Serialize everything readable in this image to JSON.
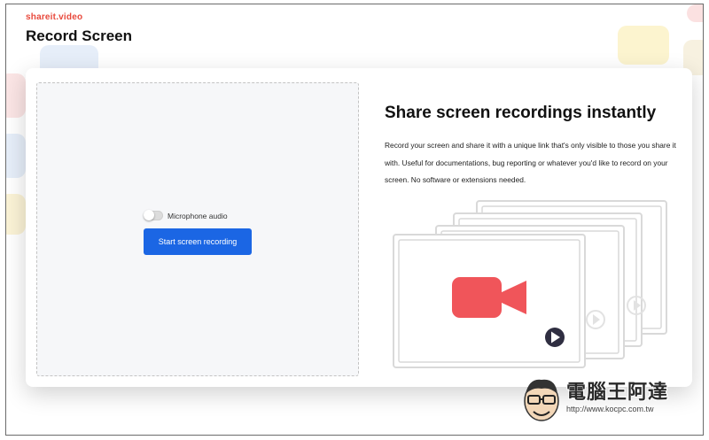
{
  "header": {
    "brand": "shareit.video",
    "page_title": "Record Screen"
  },
  "recorder": {
    "mic_label": "Microphone audio",
    "mic_enabled": false,
    "start_button_label": "Start screen recording"
  },
  "info": {
    "heading": "Share screen recordings instantly",
    "description": "Record your screen and share it with a unique link that's only visible to those you share it with. Useful for documentations, bug reporting or whatever you'd like to record on your screen. No software or extensions needed."
  },
  "illustration": {
    "camera_icon": "video-camera-icon",
    "play_icon": "play-icon"
  },
  "watermark": {
    "title": "電腦王阿達",
    "url": "http://www.kocpc.com.tw"
  },
  "colors": {
    "brand": "#e8493c",
    "button": "#1b66e4",
    "camera": "#f0555a",
    "play": "#2f2e41"
  }
}
